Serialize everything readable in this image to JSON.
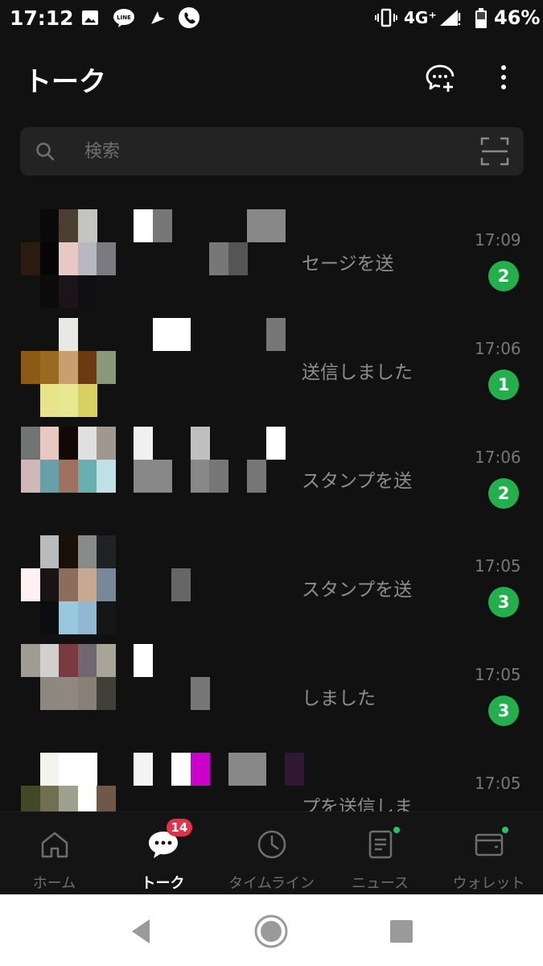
{
  "status_bar": {
    "time": "17:12",
    "network": "4G⁺",
    "battery": "46%",
    "icons": [
      "image-icon",
      "line-app-icon",
      "cursor-icon",
      "phone-icon",
      "vibrate-icon",
      "signal-icon",
      "battery-icon"
    ]
  },
  "header": {
    "title": "トーク",
    "new_chat_icon": "new-chat-icon",
    "more_icon": "more-vertical-icon"
  },
  "search": {
    "placeholder": "検索",
    "scan_icon": "qr-scan-icon"
  },
  "chats": [
    {
      "preview": "セージを送",
      "time": "17:09",
      "badge": "2",
      "avatar_colors": [
        "",
        "#0a0a0a",
        "#4a3f30",
        "#c4c4c0",
        "",
        "#2b1a0f",
        "#050505",
        "#e8c8c4",
        "#b8b8c0",
        "#7a7a80",
        "",
        "#0b0b0b",
        "#1b1418",
        "#0f0f14",
        ""
      ],
      "name_colors": [
        "#ffffff",
        "#777777",
        "",
        "",
        "",
        "",
        "#888888",
        "#888888",
        "",
        "",
        "",
        "",
        "",
        "#777777",
        "#555555"
      ]
    },
    {
      "preview": "送信しました",
      "time": "17:06",
      "badge": "1",
      "avatar_colors": [
        "",
        "",
        "#e8e8e4",
        "",
        "",
        "#8b5a14",
        "#9a6a20",
        "#c8a070",
        "#6b3a10",
        "#8a9a78",
        "",
        "#e8e48a",
        "#e8e890",
        "#d8d060",
        ""
      ],
      "name_colors": [
        "",
        "#ffffff",
        "#ffffff",
        "",
        "",
        "",
        "",
        "#777777",
        "",
        "",
        "",
        "",
        "",
        "",
        ""
      ]
    },
    {
      "preview": "スタンプを送",
      "time": "17:06",
      "badge": "2",
      "avatar_colors": [
        "#707574",
        "#e8c8c0",
        "#120808",
        "#e0e0e0",
        "#a09890",
        "#d0b8b8",
        "#68a0a8",
        "#a07060",
        "#68b0b0",
        "#c0e0e8",
        "",
        "",
        "",
        "",
        ""
      ],
      "name_colors": [
        "#f0f0f0",
        "",
        "",
        "#c0c0c0",
        "",
        "",
        "",
        "#ffffff",
        "",
        "#888888",
        "#888888",
        "",
        "#888888",
        "#777777",
        "",
        "#777777"
      ]
    },
    {
      "preview": "スタンプを送",
      "time": "17:05",
      "badge": "3",
      "avatar_colors": [
        "",
        "#b8bcbc",
        "#1a1008",
        "#888c88",
        "#1e2224",
        "#fff0f4",
        "#181414",
        "#8c6c5c",
        "#c8a890",
        "#788898",
        "",
        "#0a0e10",
        "#98c8e0",
        "#90b8d0",
        "#141618"
      ],
      "name_colors": [
        "",
        "",
        "",
        "",
        "",
        "",
        "",
        "",
        "",
        "",
        "",
        "#666666",
        "",
        "",
        "",
        "",
        ""
      ]
    },
    {
      "preview": "しました",
      "time": "17:05",
      "badge": "3",
      "avatar_colors": [
        "#a09c94",
        "#d0d0cc",
        "#7a3a42",
        "#706870",
        "#a8a498",
        "",
        "#8c8880",
        "#908880",
        "#888078",
        "#404038",
        "",
        "",
        "",
        "",
        ""
      ],
      "name_colors": [
        "#ffffff",
        "",
        "",
        "",
        "",
        "",
        "",
        "",
        "",
        "",
        "",
        "",
        "#777777",
        "",
        ""
      ]
    },
    {
      "preview": "プを送信しま",
      "time": "17:05",
      "badge": "",
      "avatar_colors": [
        "",
        "#f4f4ec",
        "#ffffff",
        "#ffffff",
        "",
        "#404828",
        "#707050",
        "#a0a090",
        "#ffffff",
        "#705848",
        "",
        "",
        "",
        "",
        ""
      ],
      "name_colors": [
        "#f4f4f4",
        "",
        "#ffffff",
        "#cc00cc",
        "",
        "#888888",
        "#888888",
        "",
        "#301830",
        "",
        "",
        "",
        "",
        "",
        ""
      ]
    }
  ],
  "bottom_nav": [
    {
      "label": "ホーム",
      "icon": "home-icon",
      "active": false,
      "dot": false,
      "badge": ""
    },
    {
      "label": "トーク",
      "icon": "chat-icon",
      "active": true,
      "dot": false,
      "badge": "14"
    },
    {
      "label": "タイムライン",
      "icon": "clock-icon",
      "active": false,
      "dot": false,
      "badge": ""
    },
    {
      "label": "ニュース",
      "icon": "news-icon",
      "active": false,
      "dot": true,
      "badge": ""
    },
    {
      "label": "ウォレット",
      "icon": "wallet-icon",
      "active": false,
      "dot": true,
      "badge": ""
    }
  ],
  "system_nav": {
    "icons": [
      "back-icon",
      "home-button-icon",
      "recents-icon"
    ]
  },
  "colors": {
    "background": "#111111",
    "badge_green": "#22b04c",
    "alert_red": "#e5304a"
  }
}
